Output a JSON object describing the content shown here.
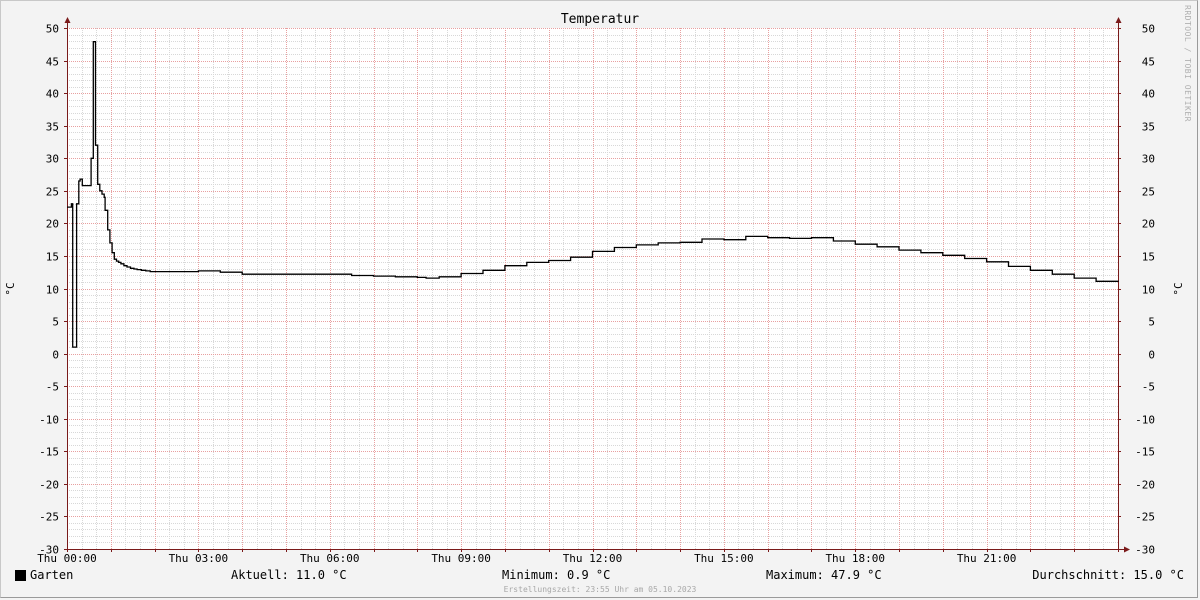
{
  "chart_data": {
    "type": "line",
    "title": "Temperatur",
    "ylabel_left": "°C",
    "ylabel_right": "°C",
    "ylim": [
      -30,
      50
    ],
    "yticks": [
      50,
      45,
      40,
      35,
      30,
      25,
      20,
      15,
      10,
      5,
      0,
      -5,
      -10,
      -15,
      -20,
      -25,
      -30
    ],
    "xlim": [
      0,
      24
    ],
    "xticks": [
      {
        "hour": 0,
        "label": "Thu 00:00"
      },
      {
        "hour": 3,
        "label": "Thu 03:00"
      },
      {
        "hour": 6,
        "label": "Thu 06:00"
      },
      {
        "hour": 9,
        "label": "Thu 09:00"
      },
      {
        "hour": 12,
        "label": "Thu 12:00"
      },
      {
        "hour": 15,
        "label": "Thu 15:00"
      },
      {
        "hour": 18,
        "label": "Thu 18:00"
      },
      {
        "hour": 21,
        "label": "Thu 21:00"
      }
    ],
    "grid": true,
    "series": [
      {
        "name": "Garten",
        "color": "#000000",
        "hours": [
          0.0,
          0.1,
          0.13,
          0.17,
          0.22,
          0.27,
          0.3,
          0.35,
          0.4,
          0.45,
          0.5,
          0.55,
          0.6,
          0.65,
          0.7,
          0.75,
          0.8,
          0.85,
          0.87,
          0.93,
          0.98,
          1.03,
          1.08,
          1.13,
          1.18,
          1.23,
          1.3,
          1.37,
          1.45,
          1.53,
          1.6,
          1.7,
          1.8,
          1.9,
          2.0,
          2.2,
          2.5,
          3.0,
          3.5,
          4.0,
          4.5,
          5.0,
          5.5,
          6.0,
          6.5,
          7.0,
          7.5,
          8.0,
          8.2,
          8.5,
          9.0,
          9.5,
          10.0,
          10.5,
          11.0,
          11.5,
          12.0,
          12.5,
          13.0,
          13.5,
          14.0,
          14.5,
          15.0,
          15.5,
          16.0,
          16.5,
          17.0,
          17.5,
          18.0,
          18.5,
          19.0,
          19.5,
          20.0,
          20.5,
          21.0,
          21.5,
          22.0,
          22.5,
          23.0,
          23.5,
          24.0
        ],
        "values": [
          22.5,
          23.0,
          1.0,
          1.0,
          23.0,
          26.5,
          26.8,
          25.8,
          25.8,
          25.8,
          25.8,
          30.0,
          47.9,
          32.0,
          26.0,
          25.0,
          24.5,
          24.0,
          22.0,
          19.0,
          17.0,
          15.5,
          14.5,
          14.2,
          14.0,
          13.8,
          13.5,
          13.3,
          13.1,
          13.0,
          12.9,
          12.8,
          12.7,
          12.6,
          12.6,
          12.6,
          12.6,
          12.7,
          12.5,
          12.2,
          12.2,
          12.2,
          12.2,
          12.2,
          12.0,
          11.9,
          11.8,
          11.7,
          11.6,
          11.8,
          12.3,
          12.8,
          13.5,
          14.0,
          14.3,
          14.8,
          15.7,
          16.3,
          16.7,
          17.0,
          17.1,
          17.6,
          17.5,
          18.0,
          17.8,
          17.7,
          17.8,
          17.3,
          16.8,
          16.4,
          15.9,
          15.5,
          15.1,
          14.6,
          14.1,
          13.4,
          12.8,
          12.2,
          11.6,
          11.1,
          11.0
        ]
      }
    ]
  },
  "legend": {
    "series_name": "Garten",
    "aktuell": "Aktuell: 11.0 °C",
    "minimum": "Minimum: 0.9 °C",
    "maximum": "Maximum: 47.9 °C",
    "durchschnitt": "Durchschnitt: 15.0 °C"
  },
  "footer": "Erstellungszeit: 23:55 Uhr am 05.10.2023",
  "watermark": "RRDTOOL / TOBI OETIKER",
  "colors": {
    "background": "#f3f3f3",
    "plot": "#ffffff",
    "major_grid": "#e8a0a0",
    "minor_grid": "#d8d8d8",
    "axis": "#7a1a1a",
    "line": "#000000"
  }
}
